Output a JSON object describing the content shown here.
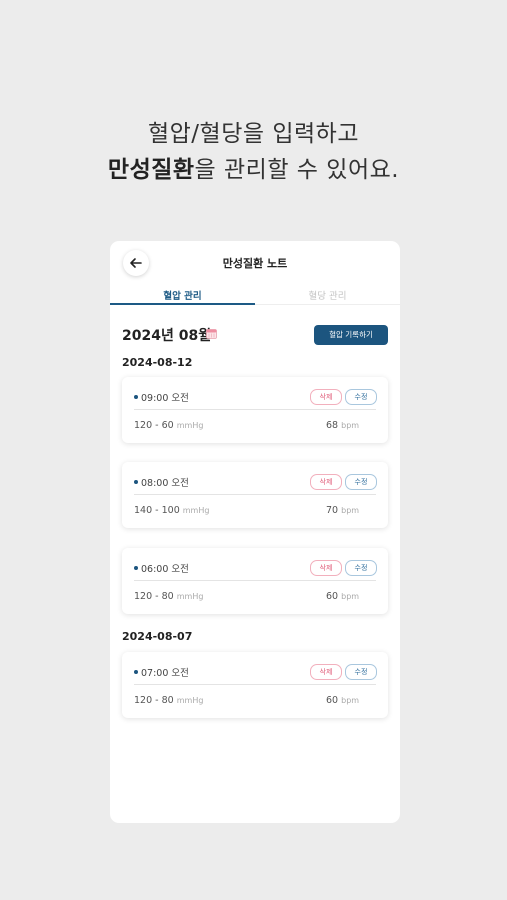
{
  "headline": {
    "line1": "혈압/혈당을 입력하고",
    "line2_bold": "만성질환",
    "line2_rest": "을 관리할 수 있어요."
  },
  "screen": {
    "title": "만성질환 노트",
    "tabs": [
      {
        "label": "혈압 관리",
        "active": true
      },
      {
        "label": "혈당 관리",
        "active": false
      }
    ],
    "month": "2024년 08월",
    "record_button": "혈압 기록하기",
    "groups": [
      {
        "date": "2024-08-12",
        "records": [
          {
            "time": "09:00 오전",
            "bp": "120 - 60",
            "bp_unit": "mmHg",
            "pulse": "68",
            "pulse_unit": "bpm"
          },
          {
            "time": "08:00 오전",
            "bp": "140 - 100",
            "bp_unit": "mmHg",
            "pulse": "70",
            "pulse_unit": "bpm"
          },
          {
            "time": "06:00 오전",
            "bp": "120 - 80",
            "bp_unit": "mmHg",
            "pulse": "60",
            "pulse_unit": "bpm"
          }
        ]
      },
      {
        "date": "2024-08-07",
        "records": [
          {
            "time": "07:00 오전",
            "bp": "120 - 80",
            "bp_unit": "mmHg",
            "pulse": "60",
            "pulse_unit": "bpm"
          }
        ]
      }
    ],
    "delete_label": "삭제",
    "edit_label": "수정"
  },
  "icons": {
    "back": "arrow-left-icon",
    "calendar": "calendar-icon"
  },
  "colors": {
    "accent": "#1c557f",
    "delete": "#e05b78",
    "background": "#ececec"
  }
}
